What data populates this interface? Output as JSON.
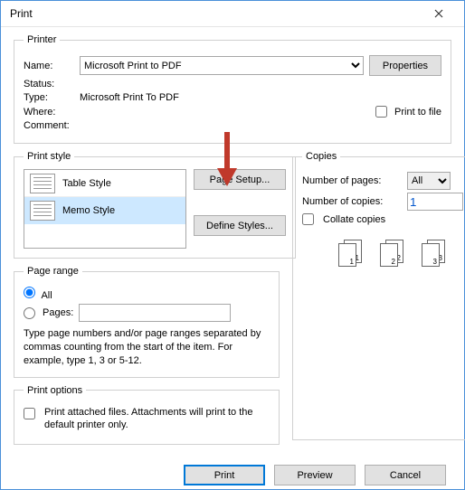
{
  "title": "Print",
  "printer": {
    "legend": "Printer",
    "name_label": "Name:",
    "name_value": "Microsoft Print to PDF",
    "properties_btn": "Properties",
    "status_label": "Status:",
    "status_value": "",
    "type_label": "Type:",
    "type_value": "Microsoft Print To PDF",
    "where_label": "Where:",
    "where_value": "",
    "comment_label": "Comment:",
    "comment_value": "",
    "print_to_file_label": "Print to file"
  },
  "style": {
    "legend": "Print style",
    "items": [
      {
        "label": "Table Style",
        "selected": false
      },
      {
        "label": "Memo Style",
        "selected": true
      }
    ],
    "page_setup_btn": "Page Setup...",
    "define_styles_btn": "Define Styles..."
  },
  "range": {
    "legend": "Page range",
    "all_label": "All",
    "pages_label": "Pages:",
    "pages_value": "",
    "hint": "Type page numbers and/or page ranges separated by commas counting from the start of the item.  For example, type 1, 3 or 5-12."
  },
  "options": {
    "legend": "Print options",
    "attached_label": "Print attached files.  Attachments will print to the default printer only."
  },
  "copies": {
    "legend": "Copies",
    "npages_label": "Number of pages:",
    "npages_value": "All",
    "ncopies_label": "Number of copies:",
    "ncopies_value": "1",
    "collate_label": "Collate copies",
    "set_labels": [
      "1",
      "2",
      "3"
    ]
  },
  "footer": {
    "print": "Print",
    "preview": "Preview",
    "cancel": "Cancel"
  }
}
